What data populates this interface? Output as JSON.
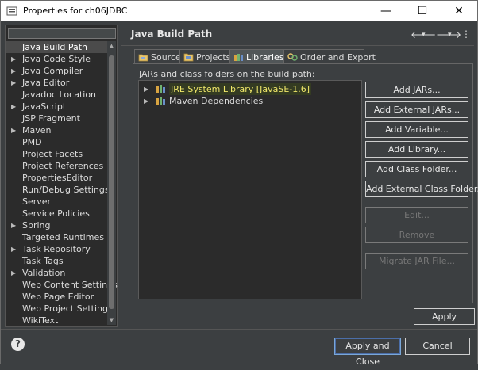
{
  "window": {
    "title": "Properties for ch06JDBC",
    "minimize_glyph": "—",
    "maximize_glyph": "☐",
    "close_glyph": "✕"
  },
  "sidebar": {
    "filter_placeholder": "",
    "items": [
      {
        "label": "Java Build Path",
        "arrow": "",
        "selected": true
      },
      {
        "label": "Java Code Style",
        "arrow": "▶"
      },
      {
        "label": "Java Compiler",
        "arrow": "▶"
      },
      {
        "label": "Java Editor",
        "arrow": "▶"
      },
      {
        "label": "Javadoc Location",
        "arrow": ""
      },
      {
        "label": "JavaScript",
        "arrow": "▶"
      },
      {
        "label": "JSP Fragment",
        "arrow": ""
      },
      {
        "label": "Maven",
        "arrow": "▶"
      },
      {
        "label": "PMD",
        "arrow": ""
      },
      {
        "label": "Project Facets",
        "arrow": ""
      },
      {
        "label": "Project References",
        "arrow": ""
      },
      {
        "label": "PropertiesEditor",
        "arrow": ""
      },
      {
        "label": "Run/Debug Settings",
        "arrow": ""
      },
      {
        "label": "Server",
        "arrow": ""
      },
      {
        "label": "Service Policies",
        "arrow": ""
      },
      {
        "label": "Spring",
        "arrow": "▶"
      },
      {
        "label": "Targeted Runtimes",
        "arrow": ""
      },
      {
        "label": "Task Repository",
        "arrow": "▶"
      },
      {
        "label": "Task Tags",
        "arrow": ""
      },
      {
        "label": "Validation",
        "arrow": "▶"
      },
      {
        "label": "Web Content Settings",
        "arrow": ""
      },
      {
        "label": "Web Page Editor",
        "arrow": ""
      },
      {
        "label": "Web Project Settings",
        "arrow": ""
      },
      {
        "label": "WikiText",
        "arrow": ""
      }
    ]
  },
  "header": {
    "page_title": "Java Build Path",
    "back_glyph": "🡐",
    "forward_glyph": "🡒",
    "dropdown_glyph": "▾",
    "menu_glyph": "⋮"
  },
  "tabs": [
    {
      "label": "Source",
      "icon": "source-icon"
    },
    {
      "label": "Projects",
      "icon": "projects-icon"
    },
    {
      "label": "Libraries",
      "icon": "libraries-icon",
      "active": true
    },
    {
      "label": "Order and Export",
      "icon": "order-export-icon"
    }
  ],
  "libraries_panel": {
    "caption": "JARs and class folders on the build path:",
    "entries": [
      {
        "label": "JRE System Library [JavaSE-1.6]",
        "arrow": "▶",
        "selected": true
      },
      {
        "label": "Maven Dependencies",
        "arrow": "▶",
        "selected": false
      }
    ]
  },
  "buttons": [
    {
      "label": "Add JARs...",
      "enabled": true
    },
    {
      "label": "Add External JARs...",
      "enabled": true
    },
    {
      "label": "Add Variable...",
      "enabled": true
    },
    {
      "label": "Add Library...",
      "enabled": true
    },
    {
      "label": "Add Class Folder...",
      "enabled": true
    },
    {
      "label": "Add External Class Folder...",
      "enabled": true
    },
    {
      "label": "Edit...",
      "enabled": false
    },
    {
      "label": "Remove",
      "enabled": false
    },
    {
      "label": "Migrate JAR File...",
      "enabled": false
    }
  ],
  "apply_label": "Apply",
  "footer": {
    "help_glyph": "?",
    "apply_close_label": "Apply and Close",
    "cancel_label": "Cancel"
  },
  "colors": {
    "background": "#3c3f41",
    "tree_background": "#2b2b2b",
    "selection_text": "#f0e76a"
  }
}
